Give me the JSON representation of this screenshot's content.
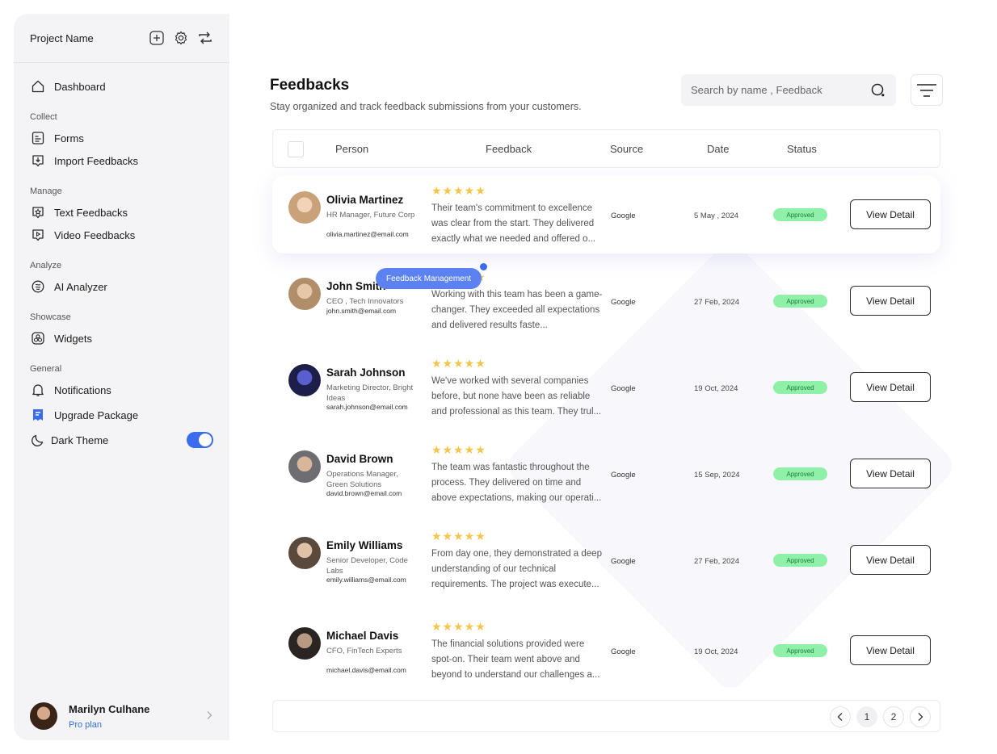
{
  "sidebar": {
    "project_name": "Project Name",
    "dashboard": "Dashboard",
    "sections": {
      "collect": "Collect",
      "manage": "Manage",
      "analyze": "Analyze",
      "showcase": "Showcase",
      "general": "General"
    },
    "items": {
      "forms": "Forms",
      "import_feedbacks": "Import Feedbacks",
      "text_feedbacks": "Text Feedbacks",
      "video_feedbacks": "Video Feedbacks",
      "ai_analyzer": "AI Analyzer",
      "widgets": "Widgets",
      "notifications": "Notifications",
      "upgrade_package": "Upgrade Package",
      "dark_theme": "Dark Theme"
    },
    "dark_theme_on": true,
    "user": {
      "name": "Marilyn Culhane",
      "plan": "Pro plan"
    }
  },
  "main": {
    "title": "Feedbacks",
    "subtitle": "Stay organized and track feedback submissions from your customers.",
    "search_placeholder": "Search by name , Feedback",
    "columns": {
      "person": "Person",
      "feedback": "Feedback",
      "source": "Source",
      "date": "Date",
      "status": "Status"
    },
    "tooltip": "Feedback Management",
    "view_label": "View Detail",
    "rows": [
      {
        "name": "Olivia Martinez",
        "role": "HR Manager, Future Corp",
        "email": "olivia.martinez@email.com",
        "stars": "★★★★★",
        "feedback": "Their team's commitment to excellence was clear from the start. They delivered exactly what we needed and offered o...",
        "source": "Google",
        "date": "5 May , 2024",
        "status": "Approved"
      },
      {
        "name": "John Smith",
        "role": "CEO , Tech Innovators",
        "email": "john.smith@email.com",
        "stars": "★★★★★",
        "feedback": "Working with this team has been a game-changer. They exceeded all expectations and delivered results faste...",
        "source": "Google",
        "date": "27 Feb, 2024",
        "status": "Approved"
      },
      {
        "name": "Sarah Johnson",
        "role": "Marketing Director, Bright Ideas",
        "email": "sarah.johnson@email.com",
        "stars": "★★★★★",
        "feedback": "We've worked with several companies before, but none have been as reliable and professional as this team. They trul...",
        "source": "Google",
        "date": "19 Oct, 2024",
        "status": "Approved"
      },
      {
        "name": "David Brown",
        "role": "Operations Manager, Green Solutions",
        "email": "david.brown@email.com",
        "stars": "★★★★★",
        "feedback": "The team was fantastic throughout the process. They delivered on time and above expectations, making our operati...",
        "source": "Google",
        "date": "15 Sep, 2024",
        "status": "Approved"
      },
      {
        "name": "Emily Williams",
        "role": "Senior Developer, Code Labs",
        "email": "emily.williams@email.com",
        "stars": "★★★★★",
        "feedback": "From day one, they demonstrated a deep understanding of our technical requirements. The project was execute...",
        "source": "Google",
        "date": "27 Feb, 2024",
        "status": "Approved"
      },
      {
        "name": "Michael Davis",
        "role": "CFO, FinTech Experts",
        "email": "michael.davis@email.com",
        "stars": "★★★★★",
        "feedback": "The financial solutions provided were spot-on. Their team went above and beyond to understand our challenges a...",
        "source": "Google",
        "date": "19 Oct, 2024",
        "status": "Approved"
      }
    ],
    "pagination": {
      "page1": "1",
      "page2": "2",
      "current": 1
    }
  },
  "colors": {
    "accent": "#3b6cf0",
    "status_bg": "#8ff0a8",
    "star": "#f4c54a",
    "plan_link": "#2f6fe0"
  }
}
